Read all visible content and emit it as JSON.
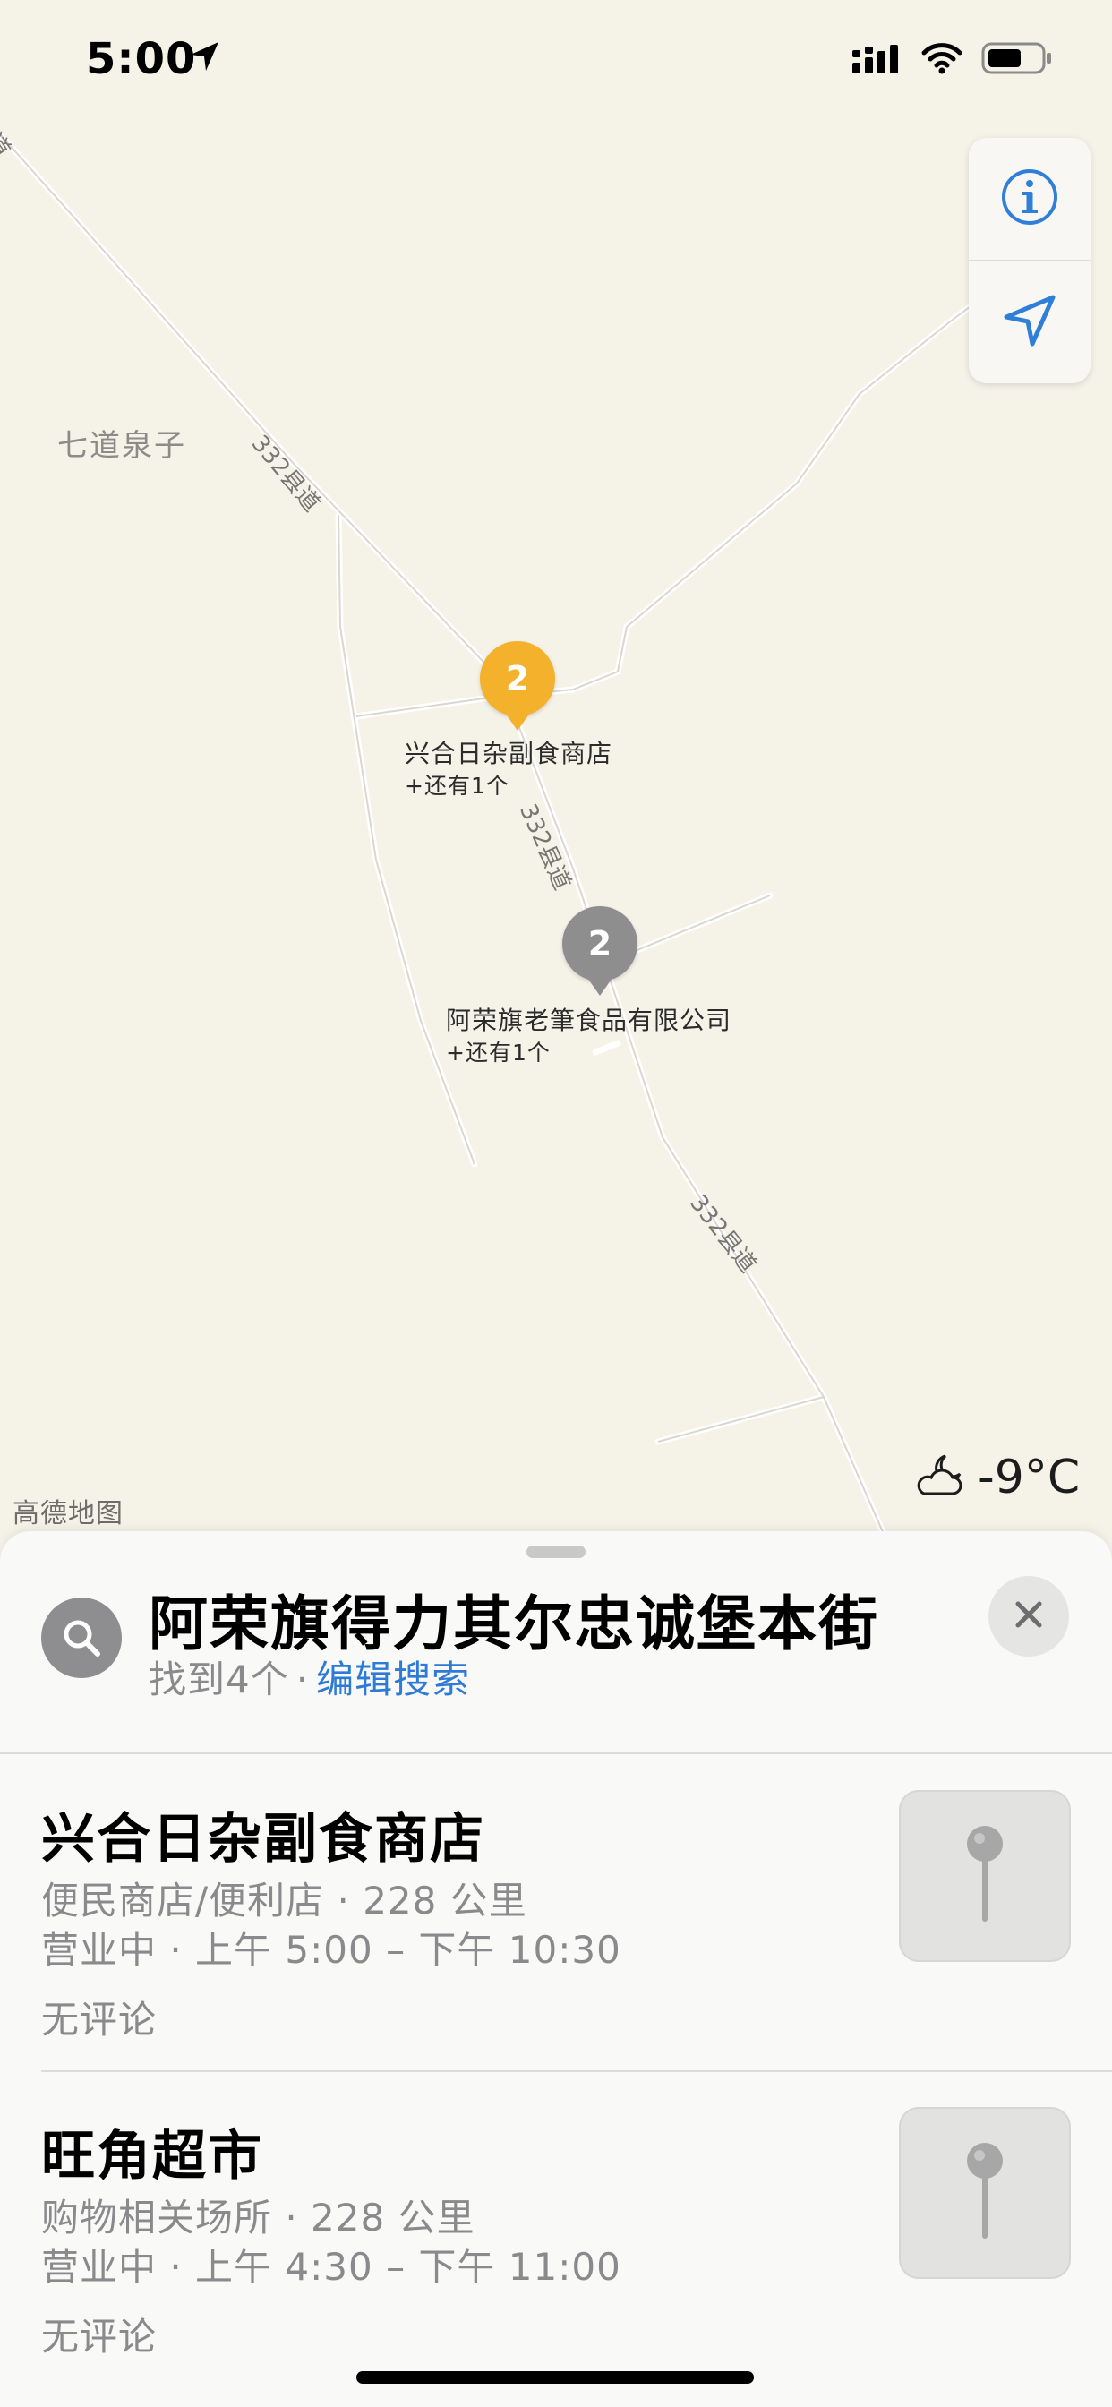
{
  "status_bar": {
    "time": "5:00",
    "location_icon": "location-arrow-icon",
    "signal_icon": "cellular-signal-icon",
    "wifi_icon": "wifi-icon",
    "battery_icon": "battery-icon"
  },
  "map": {
    "place_label": "七道泉子",
    "road_labels": [
      "332县道",
      "332县道",
      "332县道"
    ],
    "corner_road_label": "道",
    "provider_logo": "高德地图",
    "weather": {
      "icon": "partly-cloudy-night-icon",
      "temperature": "-9°C"
    },
    "pins": [
      {
        "count": "2",
        "title": "兴合日杂副食商店",
        "subtitle": "+还有1个",
        "color": "#f4b12c"
      },
      {
        "count": "2",
        "title": "阿荣旗老筆食品有限公司",
        "subtitle": "+还有1个",
        "color": "#8e8e8e"
      }
    ]
  },
  "controls": {
    "info_icon": "info-icon",
    "locate_icon": "navigation-arrow-icon",
    "accent_color": "#2f7fd8"
  },
  "sheet": {
    "search_query": "阿荣旗得力其尔忠诚堡本街",
    "result_count": "找到4个",
    "separator": "·",
    "edit_search_label": "编辑搜索",
    "results": [
      {
        "name": "兴合日杂副食商店",
        "category_distance": "便民商店/便利店 · 228 公里",
        "hours": "营业中 · 上午 5:00 – 下午 10:30",
        "reviews": "无评论"
      },
      {
        "name": "旺角超市",
        "category_distance": "购物相关场所 · 228 公里",
        "hours": "营业中 · 上午 4:30 – 下午 11:00",
        "reviews": "无评论"
      }
    ]
  }
}
